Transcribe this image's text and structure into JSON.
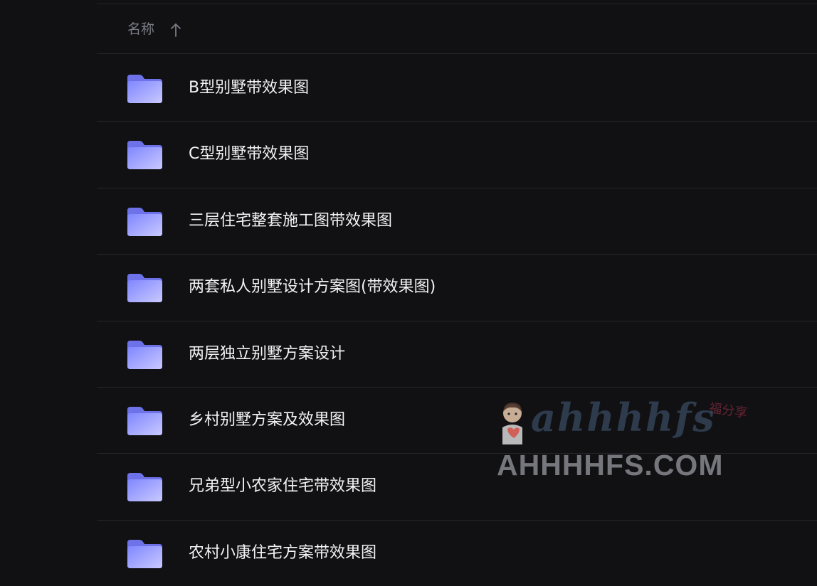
{
  "header": {
    "name_label": "名称",
    "sort_direction": "ascending"
  },
  "rows": [
    {
      "label": "B型别墅带效果图",
      "icon": "folder-icon"
    },
    {
      "label": "C型别墅带效果图",
      "icon": "folder-icon"
    },
    {
      "label": "三层住宅整套施工图带效果图",
      "icon": "folder-icon"
    },
    {
      "label": "两套私人别墅设计方案图(带效果图)",
      "icon": "folder-icon"
    },
    {
      "label": "两层独立别墅方案设计",
      "icon": "folder-icon"
    },
    {
      "label": "乡村别墅方案及效果图",
      "icon": "folder-icon"
    },
    {
      "label": "兄弟型小农家住宅带效果图",
      "icon": "folder-icon"
    },
    {
      "label": "农村小康住宅方案带效果图",
      "icon": "folder-icon"
    }
  ],
  "watermark": {
    "script_text": "ahhhhfs",
    "domain_text": "AHHHHFS.COM",
    "badge_text": "福分享"
  },
  "colors": {
    "background": "#111114",
    "divider": "#25252c",
    "text": "#f3f3f5",
    "header_text": "#7b7b85",
    "folder_accent": "#8c92ff"
  }
}
